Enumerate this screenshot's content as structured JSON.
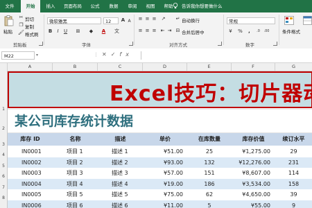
{
  "tabs": [
    "文件",
    "开始",
    "插入",
    "页面布局",
    "公式",
    "数据",
    "审阅",
    "视图",
    "帮助"
  ],
  "tell_me": "告诉我你想要做什么",
  "ribbon": {
    "clipboard": {
      "cut": "剪切",
      "copy": "复制",
      "format_painter": "格式刷",
      "paste": "粘贴",
      "group": "剪贴板"
    },
    "font": {
      "name": "微软雅黑",
      "size": "12",
      "group": "字体"
    },
    "alignment": {
      "wrap": "自动换行",
      "merge": "合并后居中",
      "group": "对齐方式"
    },
    "number": {
      "format": "常规",
      "group": "数字"
    },
    "styles": {
      "conditional": "条件格式"
    }
  },
  "formula_bar": {
    "name_box": "M22",
    "value": ""
  },
  "columns": [
    "A",
    "B",
    "C",
    "D",
    "E",
    "F",
    "G"
  ],
  "rows": [
    "1",
    "2",
    "3",
    "4",
    "5",
    "6",
    "7",
    "8",
    "9",
    "10"
  ],
  "sheet": {
    "banner": "Excel技巧：切片器动",
    "subtitle": "某公司库存统计数据",
    "headers": [
      "库存 ID",
      "名称",
      "描述",
      "单价",
      "在库数量",
      "库存价值",
      "续订水平"
    ],
    "data": [
      [
        "IN0001",
        "项目 1",
        "描述 1",
        "¥51.00",
        "25",
        "¥1,275.00",
        "29"
      ],
      [
        "IN0002",
        "项目 2",
        "描述 2",
        "¥93.00",
        "132",
        "¥12,276.00",
        "231"
      ],
      [
        "IN0003",
        "项目 3",
        "描述 3",
        "¥57.00",
        "151",
        "¥8,607.00",
        "114"
      ],
      [
        "IN0004",
        "项目 4",
        "描述 4",
        "¥19.00",
        "186",
        "¥3,534.00",
        "158"
      ],
      [
        "IN0005",
        "项目 5",
        "描述 5",
        "¥75.00",
        "62",
        "¥4,650.00",
        "39"
      ],
      [
        "IN0006",
        "项目 6",
        "描述 6",
        "¥11.00",
        "5",
        "¥55.00",
        "9"
      ]
    ]
  },
  "colors": {
    "ribbon_green": "#217346",
    "banner_fill": "#c4dde3",
    "banner_text": "#c00000",
    "subtitle_text": "#2e6f7e",
    "header_fill": "#c8d7ea",
    "band_fill": "#dbe9f6"
  }
}
